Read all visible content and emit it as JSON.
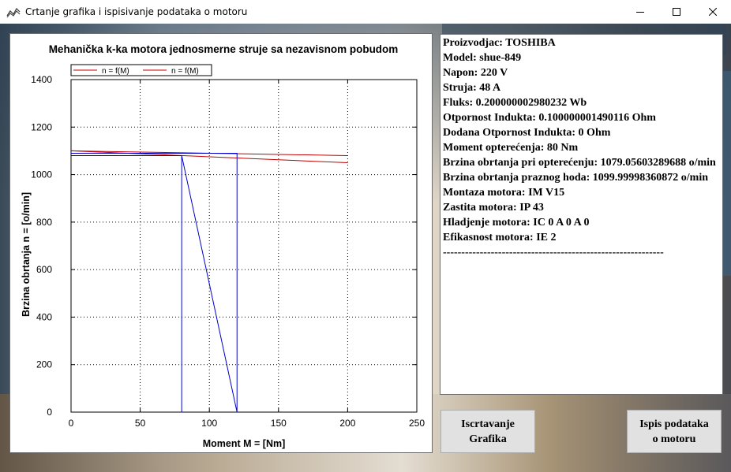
{
  "window": {
    "title": "Crtanje grafika i ispisivanje podataka o motoru",
    "icon": "chart-line-icon"
  },
  "chart_data": {
    "type": "line",
    "title": "Mehanička k-ka motora jednosmerne struje sa nezavisnom pobudom",
    "xlabel": "Moment M = [Nm]",
    "ylabel": "Brzina obrtanja n = [o/min]",
    "xlim": [
      0,
      250
    ],
    "ylim": [
      0,
      1400
    ],
    "xticks": [
      0,
      50,
      100,
      150,
      200,
      250
    ],
    "yticks": [
      0,
      200,
      400,
      600,
      800,
      1000,
      1200,
      1400
    ],
    "grid": true,
    "legend_position": "top-left",
    "series": [
      {
        "name": "n = f(M)",
        "color": "#c00000",
        "points": [
          [
            0,
            1100
          ],
          [
            200,
            1050
          ]
        ]
      },
      {
        "name": "n = f(M)",
        "color": "#c00000",
        "points": [
          [
            0,
            1100
          ],
          [
            200,
            1080
          ]
        ]
      },
      {
        "name": "",
        "color": "#0000c8",
        "points": [
          [
            0,
            1080
          ],
          [
            80,
            1080
          ],
          [
            80,
            0
          ],
          [
            80,
            1080
          ],
          [
            120,
            0
          ],
          [
            120,
            1090
          ],
          [
            0,
            1090
          ]
        ]
      }
    ]
  },
  "info": {
    "lines": [
      "Proizvodjac: TOSHIBA",
      "Model: shue-849",
      "Napon: 220 V",
      "Struja: 48 A",
      "Fluks: 0.200000002980232 Wb",
      "Otpornost Indukta: 0.100000001490116 Ohm",
      "Dodana Otpornost Indukta: 0 Ohm",
      "Moment opterećenja: 80 Nm",
      "Brzina obrtanja pri opterećenju: 1079.05603289688 o/min",
      "Brzina obrtanja praznog hoda: 1099.99998360872 o/min",
      "Montaza motora: IM V15",
      "Zastita motora: IP 43",
      "Hladjenje motora: IC 0 A 0 A 0",
      "Efikasnost motora: IE 2",
      "------------------------------------------------------------"
    ]
  },
  "buttons": {
    "plot_line1": "Iscrtavanje",
    "plot_line2": "Grafika",
    "print_line1": "Ispis podataka",
    "print_line2": "o motoru"
  }
}
